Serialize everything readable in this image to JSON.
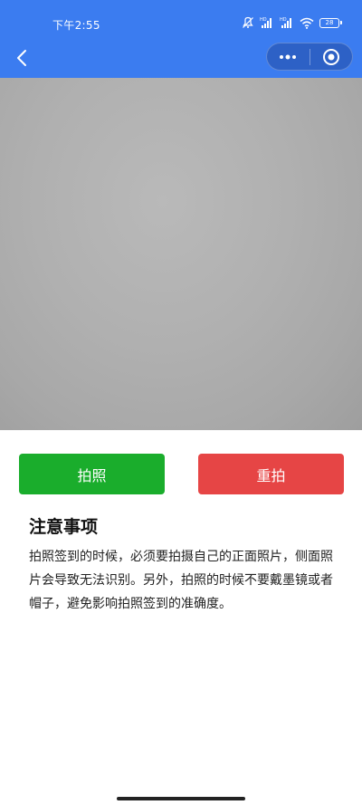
{
  "status_bar": {
    "time": "下午2:55",
    "battery": "28",
    "icons": [
      "mute-icon",
      "signal-hd-icon",
      "signal-hd-icon",
      "wifi-icon",
      "battery-icon"
    ]
  },
  "nav": {
    "back_icon": "chevron-left-icon",
    "menu_icon": "more-dots-icon",
    "close_icon": "target-circle-icon",
    "accent_color": "#3b7cf0"
  },
  "camera": {
    "preview_color": "#b0b0b0"
  },
  "actions": {
    "capture_label": "拍照",
    "retake_label": "重拍",
    "capture_color": "#1aad2c",
    "retake_color": "#e64545"
  },
  "notice": {
    "title": "注意事项",
    "body": "拍照签到的时候，必须要拍摄自己的正面照片，侧面照片会导致无法识别。另外，拍照的时候不要戴墨镜或者帽子，避免影响拍照签到的准确度。"
  }
}
